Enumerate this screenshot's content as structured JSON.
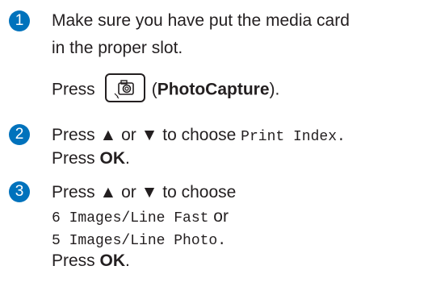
{
  "accent_color": "#0072bc",
  "steps": [
    {
      "number": "1",
      "line1": "Make sure you have put the media card",
      "line2": "in the proper slot.",
      "press_prefix": "Press",
      "button_icon": "camera-icon",
      "paren_open": "(",
      "button_name": "PhotoCapture",
      "paren_close": ")."
    },
    {
      "number": "2",
      "choose_text": "Press ▲ or ▼ to choose",
      "option": "Print Index.",
      "press_prefix": "Press",
      "ok": "OK",
      "period": "."
    },
    {
      "number": "3",
      "choose_text": "Press ▲ or ▼ to choose",
      "option1": "6 Images/Line Fast",
      "or": "or",
      "option2": "5 Images/Line Photo.",
      "press_prefix": "Press",
      "ok": "OK",
      "period": "."
    }
  ]
}
